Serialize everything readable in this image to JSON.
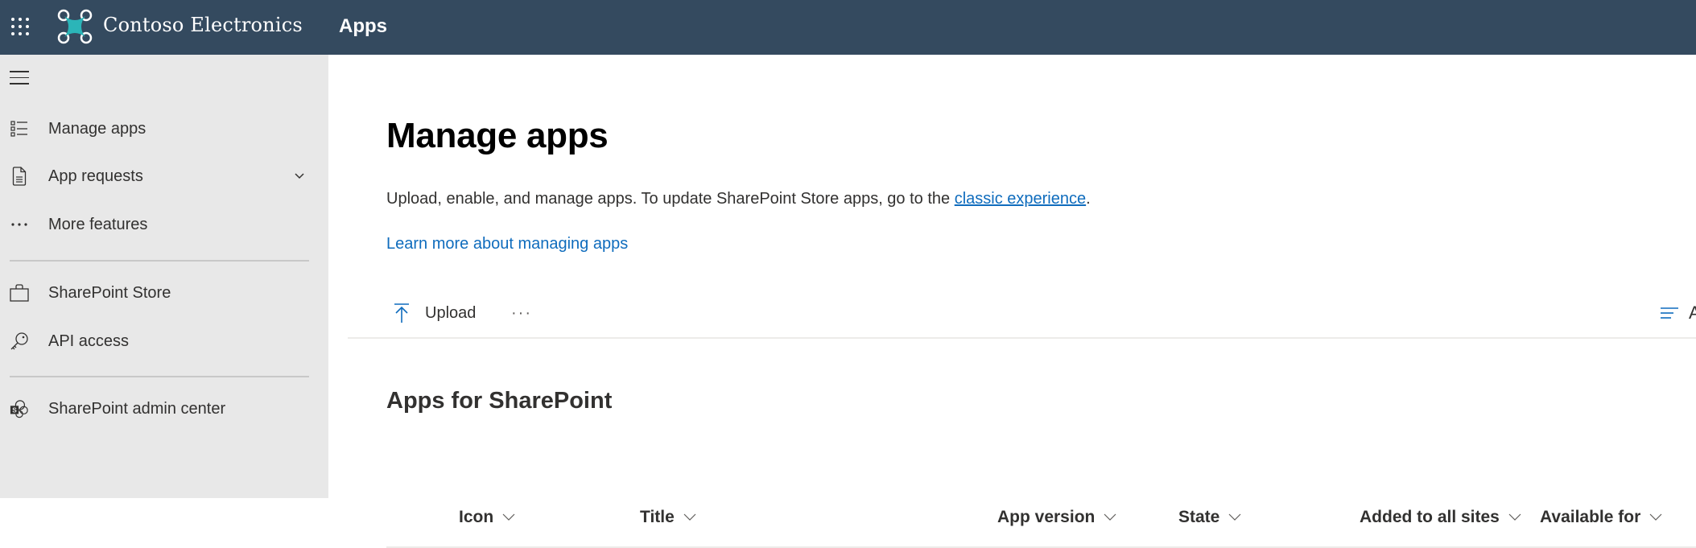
{
  "topbar": {
    "waffle_icon": "app-launcher-icon",
    "logo_icon": "contoso-drone-logo",
    "brand": "Contoso Electronics",
    "app_title": "Apps",
    "colors": {
      "background": "#344a5f",
      "logo_accent": "#2bb5b8"
    }
  },
  "sidebar": {
    "menu_icon": "hamburger-icon",
    "background": "#e8e8e8",
    "items": [
      {
        "label": "Manage apps",
        "icon": "bulleted-list-icon"
      },
      {
        "label": "App requests",
        "icon": "document-icon",
        "expandable": true
      },
      {
        "label": "More features",
        "icon": "more-icon"
      },
      {
        "label": "SharePoint Store",
        "icon": "shopping-bag-icon"
      },
      {
        "label": "API access",
        "icon": "key-icon"
      },
      {
        "label": "SharePoint admin center",
        "icon": "sharepoint-logo-icon"
      }
    ]
  },
  "main": {
    "title": "Manage apps",
    "description_prefix": "Upload, enable, and manage apps. To update SharePoint Store apps, go to the ",
    "description_link": "classic experience",
    "description_suffix": ".",
    "learn_more": "Learn more about managing apps",
    "link_color": "#0f6cbd",
    "commandbar": {
      "upload_label": "Upload",
      "upload_icon": "upload-arrow-icon",
      "more_label": "···",
      "view_label": "Ap",
      "view_icon": "view-list-icon"
    },
    "section_title": "Apps for SharePoint",
    "columns": [
      {
        "label": "Icon"
      },
      {
        "label": "Title"
      },
      {
        "label": "App version"
      },
      {
        "label": "State"
      },
      {
        "label": "Added to all sites"
      },
      {
        "label": "Available for"
      }
    ]
  }
}
